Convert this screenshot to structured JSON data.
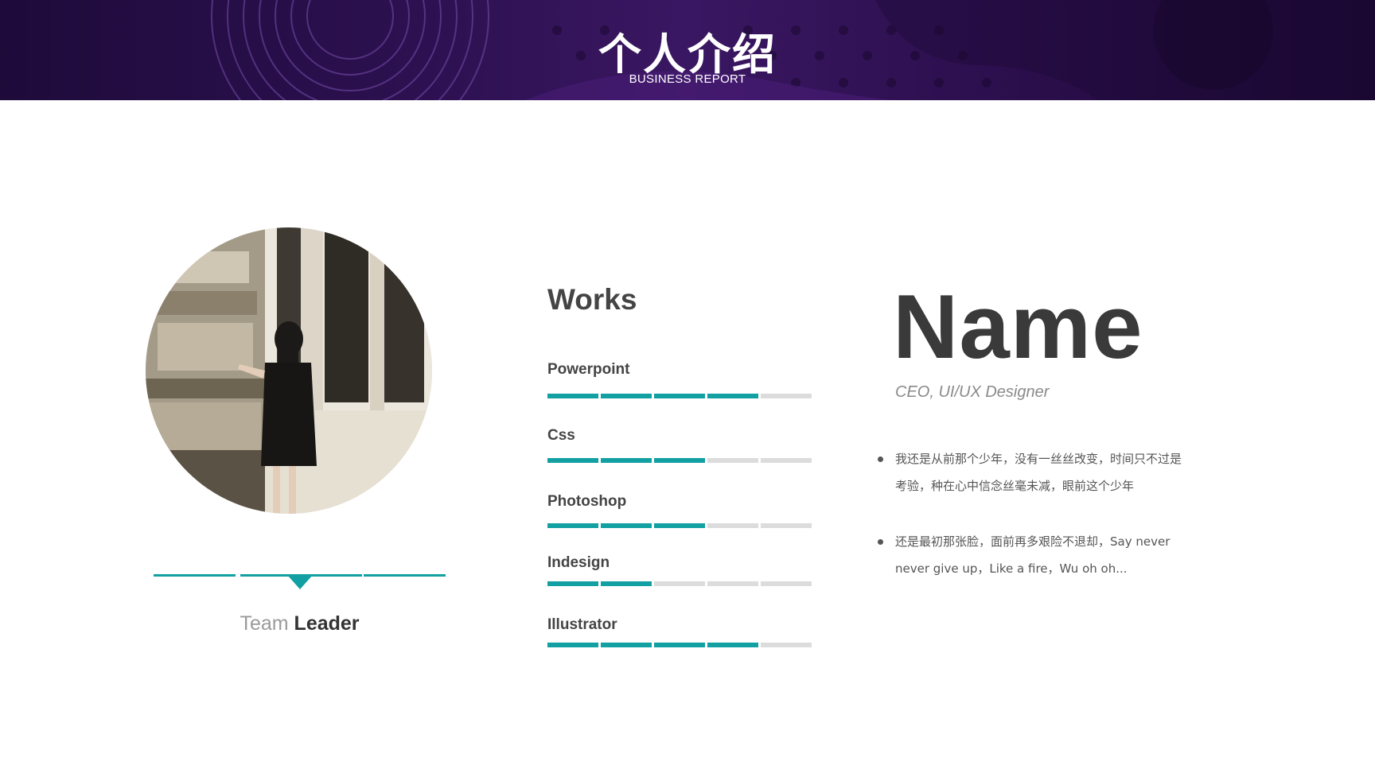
{
  "header": {
    "title": "个人介绍",
    "subtitle": "BUSINESS REPORT"
  },
  "profile": {
    "role_light": "Team",
    "role_bold": "Leader"
  },
  "works": {
    "title": "Works",
    "segments_total": 5,
    "skills": [
      {
        "label": "Powerpoint",
        "level": 4
      },
      {
        "label": "Css",
        "level": 3
      },
      {
        "label": "Photoshop",
        "level": 3
      },
      {
        "label": "Indesign",
        "level": 2
      },
      {
        "label": "Illustrator",
        "level": 4
      }
    ]
  },
  "person": {
    "name": "Name",
    "job_title": "CEO, UI/UX Designer",
    "bullets": [
      {
        "line1": "我还是从前那个少年，没有一丝丝改变，时间只不过是",
        "line2": "考验，种在心中信念丝毫未减，眼前这个少年"
      },
      {
        "line1": "还是最初那张脸，面前再多艰险不退却，Say never",
        "line2": "never give up，Like a fire，Wu oh oh..."
      }
    ]
  },
  "colors": {
    "accent": "#12a0a2",
    "inactive": "#dcdcdc",
    "header_dark": "#1e0b3a",
    "header_mid": "#3a1762"
  }
}
